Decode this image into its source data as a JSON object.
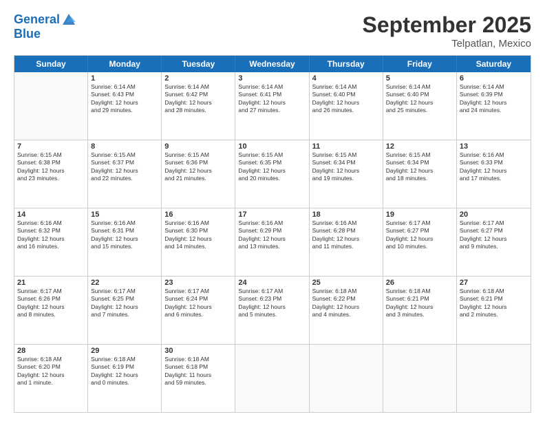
{
  "logo": {
    "line1": "General",
    "line2": "Blue"
  },
  "title": "September 2025",
  "subtitle": "Telpatlan, Mexico",
  "header_days": [
    "Sunday",
    "Monday",
    "Tuesday",
    "Wednesday",
    "Thursday",
    "Friday",
    "Saturday"
  ],
  "rows": [
    [
      {
        "day": "",
        "info": ""
      },
      {
        "day": "1",
        "info": "Sunrise: 6:14 AM\nSunset: 6:43 PM\nDaylight: 12 hours\nand 29 minutes."
      },
      {
        "day": "2",
        "info": "Sunrise: 6:14 AM\nSunset: 6:42 PM\nDaylight: 12 hours\nand 28 minutes."
      },
      {
        "day": "3",
        "info": "Sunrise: 6:14 AM\nSunset: 6:41 PM\nDaylight: 12 hours\nand 27 minutes."
      },
      {
        "day": "4",
        "info": "Sunrise: 6:14 AM\nSunset: 6:40 PM\nDaylight: 12 hours\nand 26 minutes."
      },
      {
        "day": "5",
        "info": "Sunrise: 6:14 AM\nSunset: 6:40 PM\nDaylight: 12 hours\nand 25 minutes."
      },
      {
        "day": "6",
        "info": "Sunrise: 6:14 AM\nSunset: 6:39 PM\nDaylight: 12 hours\nand 24 minutes."
      }
    ],
    [
      {
        "day": "7",
        "info": "Sunrise: 6:15 AM\nSunset: 6:38 PM\nDaylight: 12 hours\nand 23 minutes."
      },
      {
        "day": "8",
        "info": "Sunrise: 6:15 AM\nSunset: 6:37 PM\nDaylight: 12 hours\nand 22 minutes."
      },
      {
        "day": "9",
        "info": "Sunrise: 6:15 AM\nSunset: 6:36 PM\nDaylight: 12 hours\nand 21 minutes."
      },
      {
        "day": "10",
        "info": "Sunrise: 6:15 AM\nSunset: 6:35 PM\nDaylight: 12 hours\nand 20 minutes."
      },
      {
        "day": "11",
        "info": "Sunrise: 6:15 AM\nSunset: 6:34 PM\nDaylight: 12 hours\nand 19 minutes."
      },
      {
        "day": "12",
        "info": "Sunrise: 6:15 AM\nSunset: 6:34 PM\nDaylight: 12 hours\nand 18 minutes."
      },
      {
        "day": "13",
        "info": "Sunrise: 6:16 AM\nSunset: 6:33 PM\nDaylight: 12 hours\nand 17 minutes."
      }
    ],
    [
      {
        "day": "14",
        "info": "Sunrise: 6:16 AM\nSunset: 6:32 PM\nDaylight: 12 hours\nand 16 minutes."
      },
      {
        "day": "15",
        "info": "Sunrise: 6:16 AM\nSunset: 6:31 PM\nDaylight: 12 hours\nand 15 minutes."
      },
      {
        "day": "16",
        "info": "Sunrise: 6:16 AM\nSunset: 6:30 PM\nDaylight: 12 hours\nand 14 minutes."
      },
      {
        "day": "17",
        "info": "Sunrise: 6:16 AM\nSunset: 6:29 PM\nDaylight: 12 hours\nand 13 minutes."
      },
      {
        "day": "18",
        "info": "Sunrise: 6:16 AM\nSunset: 6:28 PM\nDaylight: 12 hours\nand 11 minutes."
      },
      {
        "day": "19",
        "info": "Sunrise: 6:17 AM\nSunset: 6:27 PM\nDaylight: 12 hours\nand 10 minutes."
      },
      {
        "day": "20",
        "info": "Sunrise: 6:17 AM\nSunset: 6:27 PM\nDaylight: 12 hours\nand 9 minutes."
      }
    ],
    [
      {
        "day": "21",
        "info": "Sunrise: 6:17 AM\nSunset: 6:26 PM\nDaylight: 12 hours\nand 8 minutes."
      },
      {
        "day": "22",
        "info": "Sunrise: 6:17 AM\nSunset: 6:25 PM\nDaylight: 12 hours\nand 7 minutes."
      },
      {
        "day": "23",
        "info": "Sunrise: 6:17 AM\nSunset: 6:24 PM\nDaylight: 12 hours\nand 6 minutes."
      },
      {
        "day": "24",
        "info": "Sunrise: 6:17 AM\nSunset: 6:23 PM\nDaylight: 12 hours\nand 5 minutes."
      },
      {
        "day": "25",
        "info": "Sunrise: 6:18 AM\nSunset: 6:22 PM\nDaylight: 12 hours\nand 4 minutes."
      },
      {
        "day": "26",
        "info": "Sunrise: 6:18 AM\nSunset: 6:21 PM\nDaylight: 12 hours\nand 3 minutes."
      },
      {
        "day": "27",
        "info": "Sunrise: 6:18 AM\nSunset: 6:21 PM\nDaylight: 12 hours\nand 2 minutes."
      }
    ],
    [
      {
        "day": "28",
        "info": "Sunrise: 6:18 AM\nSunset: 6:20 PM\nDaylight: 12 hours\nand 1 minute."
      },
      {
        "day": "29",
        "info": "Sunrise: 6:18 AM\nSunset: 6:19 PM\nDaylight: 12 hours\nand 0 minutes."
      },
      {
        "day": "30",
        "info": "Sunrise: 6:18 AM\nSunset: 6:18 PM\nDaylight: 11 hours\nand 59 minutes."
      },
      {
        "day": "",
        "info": ""
      },
      {
        "day": "",
        "info": ""
      },
      {
        "day": "",
        "info": ""
      },
      {
        "day": "",
        "info": ""
      }
    ]
  ]
}
